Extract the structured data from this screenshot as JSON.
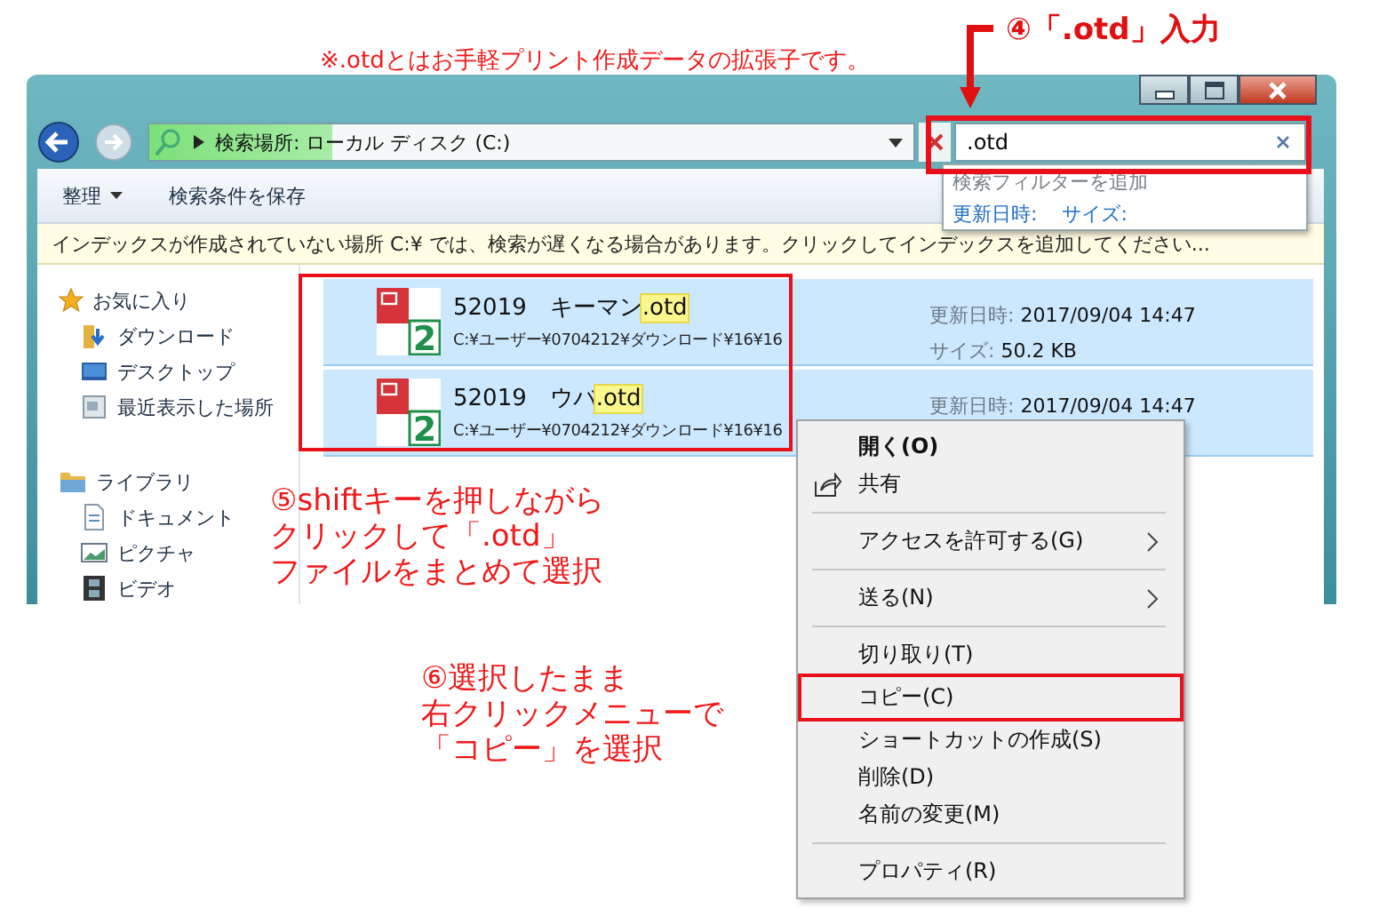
{
  "annotations": {
    "note": "※.otdとはお手軽プリント作成データの拡張子です。",
    "step4": "④「.otd」入力",
    "step5": [
      "⑤shiftキーを押しながら",
      "クリックして「.otd」",
      "ファイルをまとめて選択"
    ],
    "step6": [
      "⑥選択したまま",
      "右クリックメニューで",
      "「コピー」を選択"
    ]
  },
  "window": {
    "address": {
      "text": "検索場所: ローカル ディスク (C:)",
      "level": 0.24
    },
    "search": {
      "value": ".otd",
      "hint": "検索フィルターを追加",
      "filters": [
        "更新日時:",
        "サイズ:"
      ]
    },
    "toolbar": [
      {
        "label": "整理",
        "dropdown": true
      },
      {
        "label": "検索条件を保存",
        "dropdown": false
      }
    ],
    "info_bar": "インデックスが作成されていない場所 C:¥ では、検索が遅くなる場合があります。クリックしてインデックスを追加してください...",
    "sidebar": [
      {
        "label": "お気に入り",
        "kind": "star",
        "children": [
          {
            "label": "ダウンロード",
            "kind": "download"
          },
          {
            "label": "デスクトップ",
            "kind": "desktop"
          },
          {
            "label": "最近表示した場所",
            "kind": "recent"
          }
        ]
      },
      {
        "label": "ライブラリ",
        "kind": "library",
        "children": [
          {
            "label": "ドキュメント",
            "kind": "document"
          },
          {
            "label": "ピクチャ",
            "kind": "picture"
          },
          {
            "label": "ビデオ",
            "kind": "video"
          }
        ]
      }
    ],
    "files": [
      {
        "name": "52019　キーマン",
        "match": ".otd",
        "icon_digit": "2",
        "path": "C:¥ユーザー¥0704212¥ダウンロード¥16¥16",
        "selected": true,
        "details": [
          {
            "label": "更新日時:",
            "value": "2017/09/04 14:47"
          },
          {
            "label": "サイズ:",
            "value": "50.2 KB"
          }
        ]
      },
      {
        "name": "52019　ウバ",
        "match": ".otd",
        "icon_digit": "2",
        "path": "C:¥ユーザー¥0704212¥ダウンロード¥16¥16",
        "selected": true,
        "details": [
          {
            "label": "更新日時:",
            "value": "2017/09/04 14:47"
          }
        ]
      }
    ]
  },
  "context_menu": [
    {
      "kind": "item",
      "label": "開く(O)",
      "bold": true,
      "icon": false,
      "submenu": false,
      "marked": false
    },
    {
      "kind": "item",
      "label": "共有",
      "bold": false,
      "icon": true,
      "submenu": false,
      "marked": false
    },
    {
      "kind": "separator"
    },
    {
      "kind": "item",
      "label": "アクセスを許可する(G)",
      "bold": false,
      "icon": false,
      "submenu": true,
      "marked": false
    },
    {
      "kind": "separator"
    },
    {
      "kind": "item",
      "label": "送る(N)",
      "bold": false,
      "icon": false,
      "submenu": true,
      "marked": false
    },
    {
      "kind": "separator"
    },
    {
      "kind": "item",
      "label": "切り取り(T)",
      "bold": false,
      "icon": false,
      "submenu": false,
      "marked": false
    },
    {
      "kind": "item",
      "label": "コピー(C)",
      "bold": false,
      "icon": false,
      "submenu": false,
      "marked": true
    },
    {
      "kind": "item",
      "label": "ショートカットの作成(S)",
      "bold": false,
      "icon": false,
      "submenu": false,
      "marked": false
    },
    {
      "kind": "item",
      "label": "削除(D)",
      "bold": false,
      "icon": false,
      "submenu": false,
      "marked": false
    },
    {
      "kind": "item",
      "label": "名前の変更(M)",
      "bold": false,
      "icon": false,
      "submenu": false,
      "marked": false
    },
    {
      "kind": "separator"
    },
    {
      "kind": "item",
      "label": "プロパティ(R)",
      "bold": false,
      "icon": false,
      "submenu": false,
      "marked": false
    }
  ]
}
